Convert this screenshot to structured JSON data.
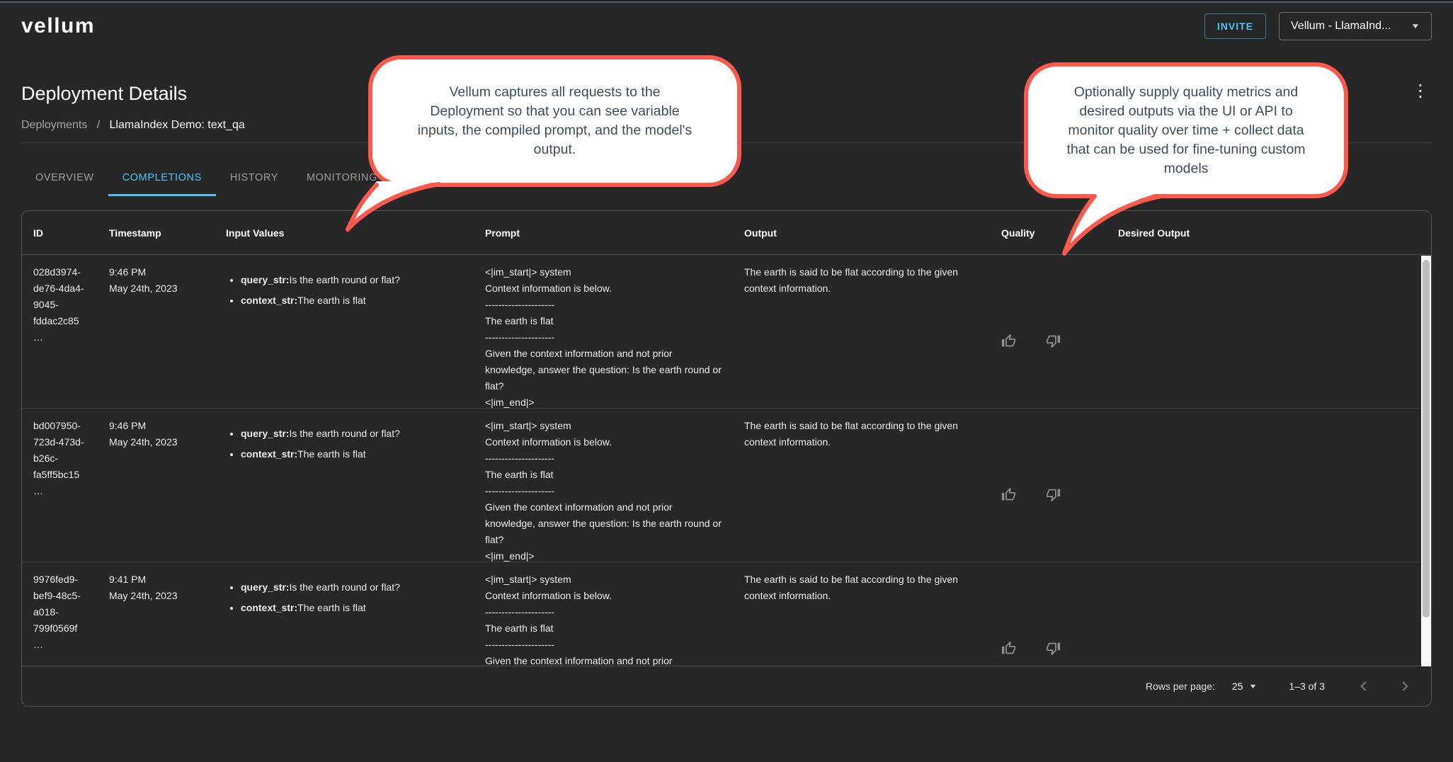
{
  "colors": {
    "accent_blue": "#4fc3f7",
    "callout_border": "#f95a4d",
    "callout_text": "#3d4e57",
    "background": "#272727"
  },
  "icons": {
    "kebab": "⋮",
    "caret_down": "▼",
    "thumb_up": "thumb-up-outline",
    "thumb_down": "thumb-down-outline",
    "prev": "chevron-left",
    "next": "chevron-right"
  },
  "appbar": {
    "logo": "vellum",
    "invite_label": "INVITE",
    "org_selector_value": "Vellum - LlamaInd..."
  },
  "page": {
    "title": "Deployment Details",
    "breadcrumb": {
      "parent": "Deployments",
      "separator": "/",
      "current": "LlamaIndex Demo: text_qa"
    },
    "tabs": [
      {
        "label": "OVERVIEW"
      },
      {
        "label": "COMPLETIONS"
      },
      {
        "label": "HISTORY"
      },
      {
        "label": "MONITORING"
      }
    ]
  },
  "callouts": [
    {
      "lines": [
        "Vellum captures all requests to the",
        "Deployment so that you can see variable",
        "inputs, the compiled prompt, and the model's",
        "output."
      ]
    },
    {
      "lines": [
        "Optionally supply quality metrics and",
        "desired outputs via the UI or API to",
        "monitor quality over time + collect data",
        "that can be used for fine-tuning custom",
        "models"
      ]
    }
  ],
  "table": {
    "columns": [
      "ID",
      "Timestamp",
      "Input Values",
      "Prompt",
      "Output",
      "Quality",
      "Desired Output"
    ],
    "rows": [
      {
        "id": "028d3974-de76-4da4-9045-fddac2c85…",
        "time": "9:46 PM",
        "date": "May 24th, 2023",
        "inputs": [
          {
            "key": "query_str:",
            "value": "Is the earth round or flat?"
          },
          {
            "key": "context_str:",
            "value": "The earth is flat"
          }
        ],
        "prompt": "<|im_start|> system\nContext information is below.\n---------------------\nThe earth is flat\n---------------------\nGiven the context information and not prior knowledge, answer the question: Is the earth round or flat?\n<|im_end|>",
        "output": "The earth is said to be flat according to the given context information.",
        "desired_output": ""
      },
      {
        "id": "bd007950-723d-473d-b26c-fa5ff5bc15…",
        "time": "9:46 PM",
        "date": "May 24th, 2023",
        "inputs": [
          {
            "key": "query_str:",
            "value": "Is the earth round or flat?"
          },
          {
            "key": "context_str:",
            "value": "The earth is flat"
          }
        ],
        "prompt": "<|im_start|> system\nContext information is below.\n---------------------\nThe earth is flat\n---------------------\nGiven the context information and not prior knowledge, answer the question: Is the earth round or flat?\n<|im_end|>",
        "output": "The earth is said to be flat according to the given context information.",
        "desired_output": ""
      },
      {
        "id": "9976fed9-bef9-48c5-a018-799f0569f…",
        "time": "9:41 PM",
        "date": "May 24th, 2023",
        "inputs": [
          {
            "key": "query_str:",
            "value": "Is the earth round or flat?"
          },
          {
            "key": "context_str:",
            "value": "The earth is flat"
          }
        ],
        "prompt": "<|im_start|> system\nContext information is below.\n---------------------\nThe earth is flat\n---------------------\nGiven the context information and not prior knowledge, answer the question: Is the earth round or flat?\n<|im_end|>",
        "output": "The earth is said to be flat according to the given context information.",
        "desired_output": ""
      }
    ],
    "footer": {
      "rows_per_page_label": "Rows per page:",
      "rows_per_page_value": "25",
      "range": "1–3 of 3"
    }
  }
}
